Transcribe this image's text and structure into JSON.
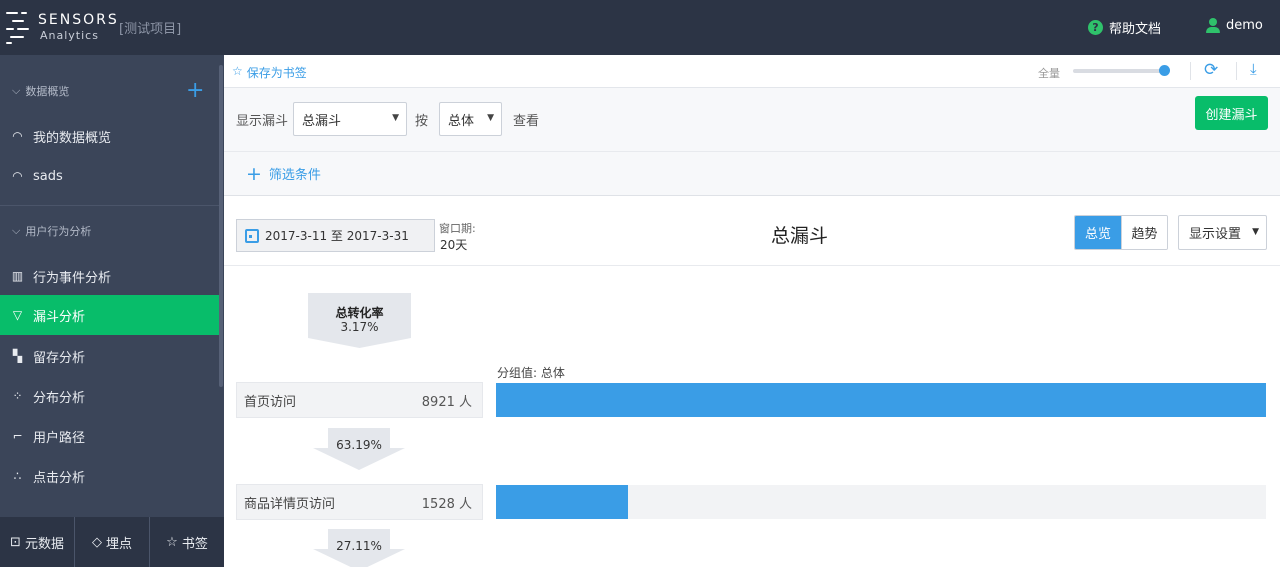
{
  "header": {
    "brand": "SENSORS",
    "brand_sub": "Analytics",
    "project": "[测试项目]",
    "help_label": "帮助文档",
    "help_glyph": "?",
    "user": "demo",
    "accent": "#2fc26b"
  },
  "sidebar": {
    "group1": "数据概览",
    "items1": [
      {
        "label": "我的数据概览",
        "icon": "dashboard-icon"
      },
      {
        "label": "sads",
        "icon": "dashboard-icon"
      }
    ],
    "group2": "用户行为分析",
    "items2": [
      {
        "label": "行为事件分析",
        "icon": "bar-chart-icon"
      },
      {
        "label": "漏斗分析",
        "icon": "funnel-icon",
        "active": true
      },
      {
        "label": "留存分析",
        "icon": "retention-icon"
      },
      {
        "label": "分布分析",
        "icon": "distribution-icon"
      },
      {
        "label": "用户路径",
        "icon": "path-icon"
      },
      {
        "label": "点击分析",
        "icon": "click-icon"
      }
    ],
    "bottom": [
      "元数据",
      "埋点",
      "书签"
    ],
    "active_color": "#08bd6a"
  },
  "toolbar": {
    "bookmark_label": "保存为书签",
    "full_label": "全量",
    "sample_level": 1.0
  },
  "query": {
    "show_label": "显示漏斗",
    "funnel_select": "总漏斗",
    "by_label": "按",
    "group_select": "总体",
    "view_label": "查看",
    "create_button": "创建漏斗",
    "filter_label": "筛选条件"
  },
  "report": {
    "date_range": "2017-3-11 至 2017-3-31",
    "window_label": "窗口期:",
    "window_value": "20天",
    "title": "总漏斗",
    "view_tabs": [
      "总览",
      "趋势"
    ],
    "active_tab": "总览",
    "display_settings": "显示设置"
  },
  "funnel": {
    "overall_label": "总转化率",
    "overall_rate": "3.17%",
    "group_label": "分组值: 总体",
    "steps": [
      {
        "name": "首页访问",
        "count": "8921 人",
        "value": 8921
      },
      {
        "name": "商品详情页访问",
        "count": "1528 人",
        "value": 1528
      }
    ],
    "conversions": [
      "63.19%",
      "27.11%"
    ],
    "bar_color": "#3a9de6"
  }
}
